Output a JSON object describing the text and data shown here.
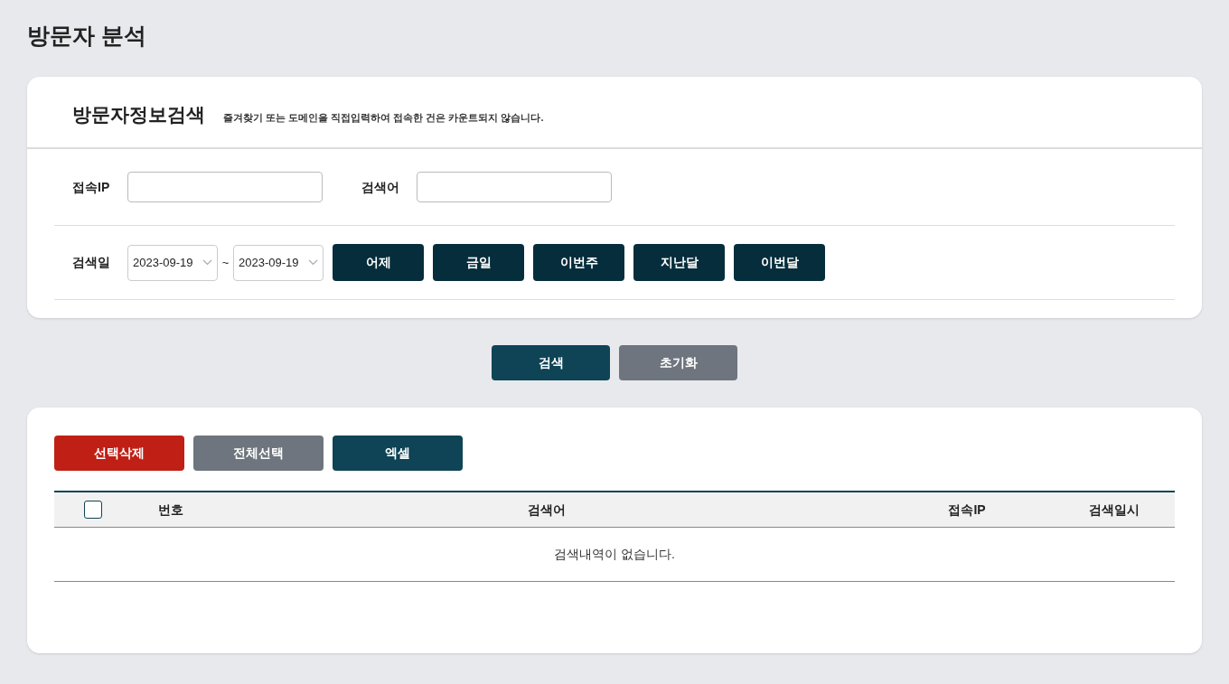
{
  "page_title": "방문자 분석",
  "search_panel": {
    "title": "방문자정보검색",
    "notice": "즐겨찾기 또는 도메인을 직접입력하여 접속한 건은 카운트되지 않습니다.",
    "fields": [
      {
        "label": "접속IP"
      },
      {
        "label": "검색어"
      }
    ],
    "date_label": "검색일",
    "date_from": "2023-09-19",
    "date_separator": "~",
    "date_to": "2023-09-19",
    "quick_ranges": [
      "어제",
      "금일",
      "이번주",
      "지난달",
      "이번달"
    ]
  },
  "form_buttons": [
    {
      "label": "검색",
      "kind": "primary"
    },
    {
      "label": "초기화",
      "kind": "secondary"
    }
  ],
  "list_buttons": [
    {
      "label": "선택삭제",
      "kind": "danger"
    },
    {
      "label": "전체선택",
      "kind": "secondary"
    },
    {
      "label": "엑셀",
      "kind": "primary"
    }
  ],
  "table": {
    "select_all_checked": false,
    "columns": [
      "번호",
      "검색어",
      "접속IP",
      "검색일시"
    ],
    "empty_message": "검색내역이 없습니다."
  }
}
